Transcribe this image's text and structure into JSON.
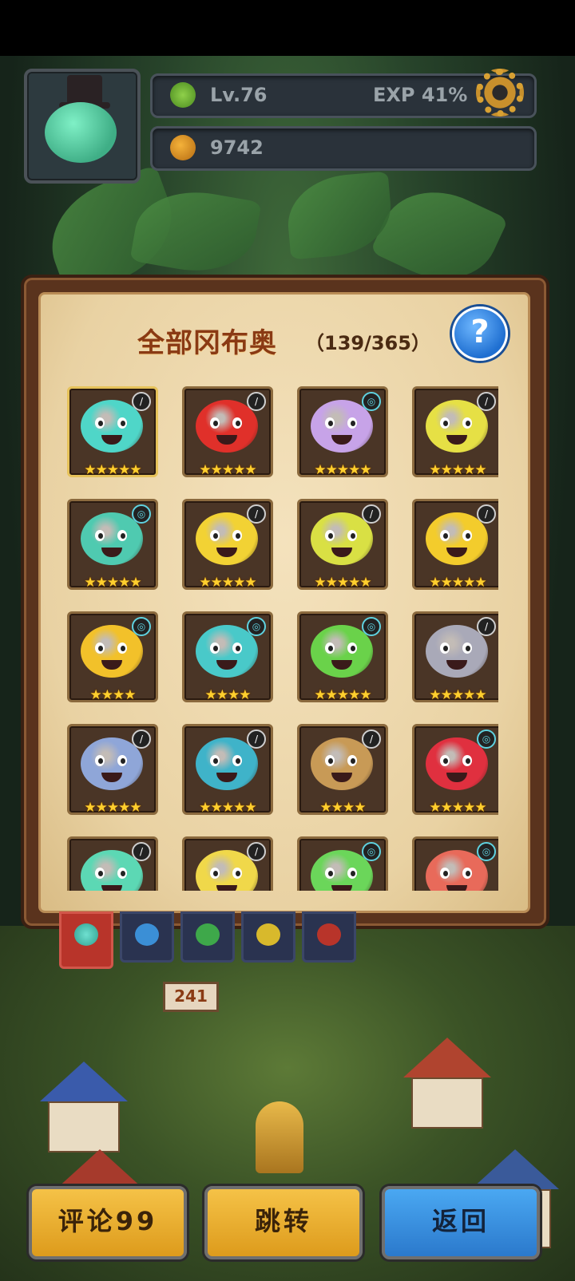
{
  "hud": {
    "level": "Lv.76",
    "exp_label": "EXP 41%",
    "exp_percent": 41,
    "currency": "9742"
  },
  "panel": {
    "title": "全部冈布奥",
    "count": "（139/365）",
    "help": "?"
  },
  "creatures": [
    {
      "color": "#4fd6c8",
      "badge": "sword",
      "stars": "★★★★★"
    },
    {
      "color": "#e0302a",
      "badge": "sword",
      "stars": "★★★★★"
    },
    {
      "color": "#c7a3e8",
      "badge": "spiral",
      "stars": "★★★★★"
    },
    {
      "color": "#e6e045",
      "badge": "sword",
      "stars": "★★★★★"
    },
    {
      "color": "#4fcab0",
      "badge": "spiral",
      "stars": "★★★★★"
    },
    {
      "color": "#f2d234",
      "badge": "sword",
      "stars": "★★★★★"
    },
    {
      "color": "#d9e044",
      "badge": "sword",
      "stars": "★★★★★"
    },
    {
      "color": "#f3cc2c",
      "badge": "sword",
      "stars": "★★★★★"
    },
    {
      "color": "#f2c12a",
      "badge": "spiral",
      "stars": "★★★★"
    },
    {
      "color": "#49c9c9",
      "badge": "spiral",
      "stars": "★★★★"
    },
    {
      "color": "#6ad24a",
      "badge": "spiral",
      "stars": "★★★★★"
    },
    {
      "color": "#a9a9b8",
      "badge": "sword",
      "stars": "★★★★★"
    },
    {
      "color": "#8fa6d8",
      "badge": "sword",
      "stars": "★★★★★"
    },
    {
      "color": "#3fb3c9",
      "badge": "sword",
      "stars": "★★★★★"
    },
    {
      "color": "#c89a56",
      "badge": "sword",
      "stars": "★★★★"
    },
    {
      "color": "#e0303f",
      "badge": "spiral",
      "stars": "★★★★★"
    },
    {
      "color": "#5cd8b4",
      "badge": "sword",
      "stars": ""
    },
    {
      "color": "#f0d84a",
      "badge": "sword",
      "stars": ""
    },
    {
      "color": "#6bd65a",
      "badge": "spiral",
      "stars": ""
    },
    {
      "color": "#e86a5a",
      "badge": "spiral",
      "stars": ""
    }
  ],
  "tabs": [
    {
      "name": "all",
      "color": "#5fd6c2",
      "active": true
    },
    {
      "name": "blue",
      "color": "#3b8fd6",
      "active": false
    },
    {
      "name": "green",
      "color": "#3ea84a",
      "active": false
    },
    {
      "name": "yellow",
      "color": "#d8b92c",
      "active": false
    },
    {
      "name": "red",
      "color": "#b8342a",
      "active": false
    }
  ],
  "map": {
    "sign": "241"
  },
  "buttons": {
    "comment": "评论99",
    "jump": "跳转",
    "back": "返回"
  }
}
